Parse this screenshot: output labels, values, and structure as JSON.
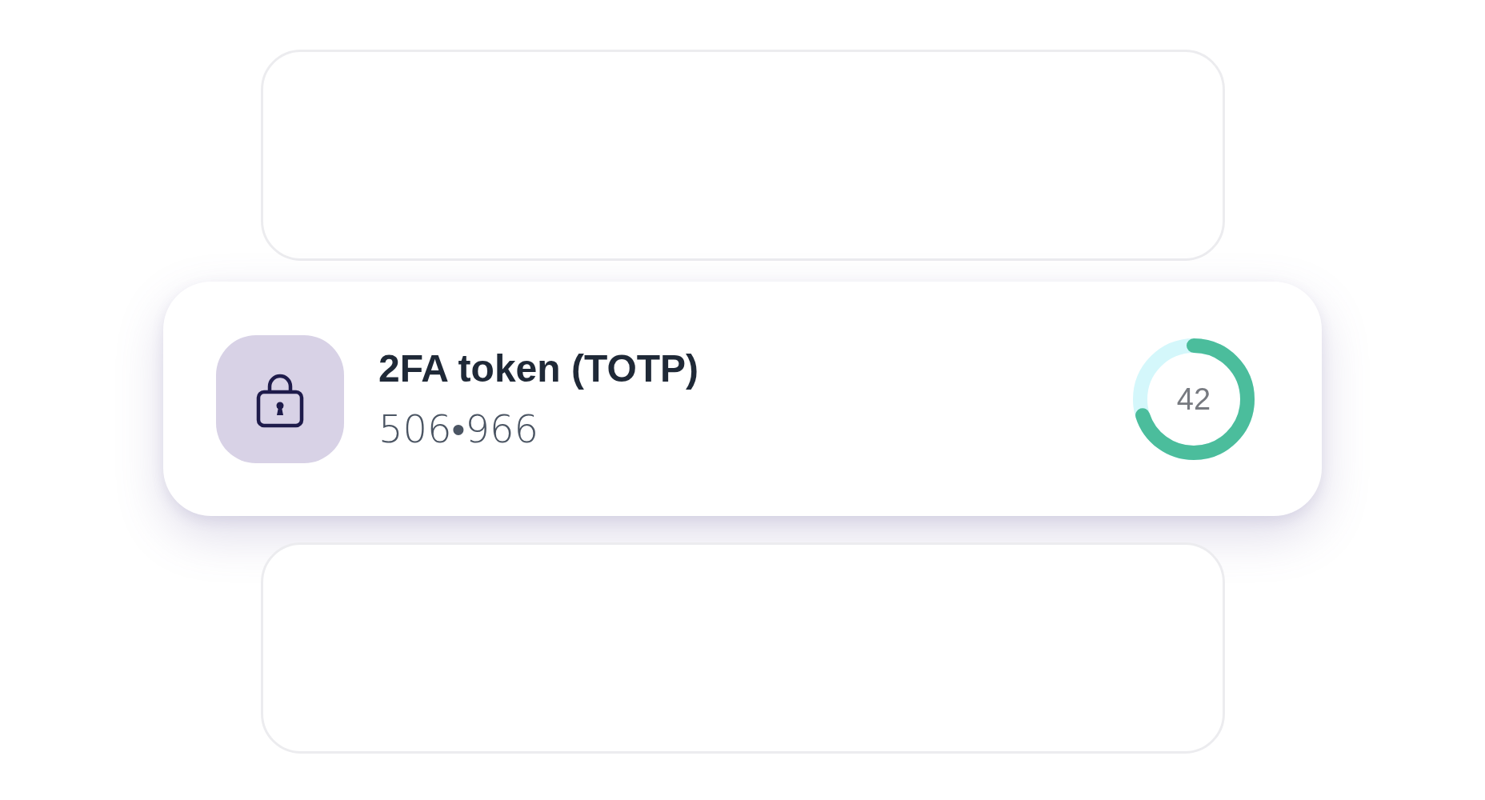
{
  "cards": [
    {
      "kind": "empty"
    },
    {
      "kind": "token",
      "title": "2FA token (TOTP)",
      "code": "506•966",
      "countdown": {
        "value": "42"
      }
    },
    {
      "kind": "empty"
    }
  ]
}
